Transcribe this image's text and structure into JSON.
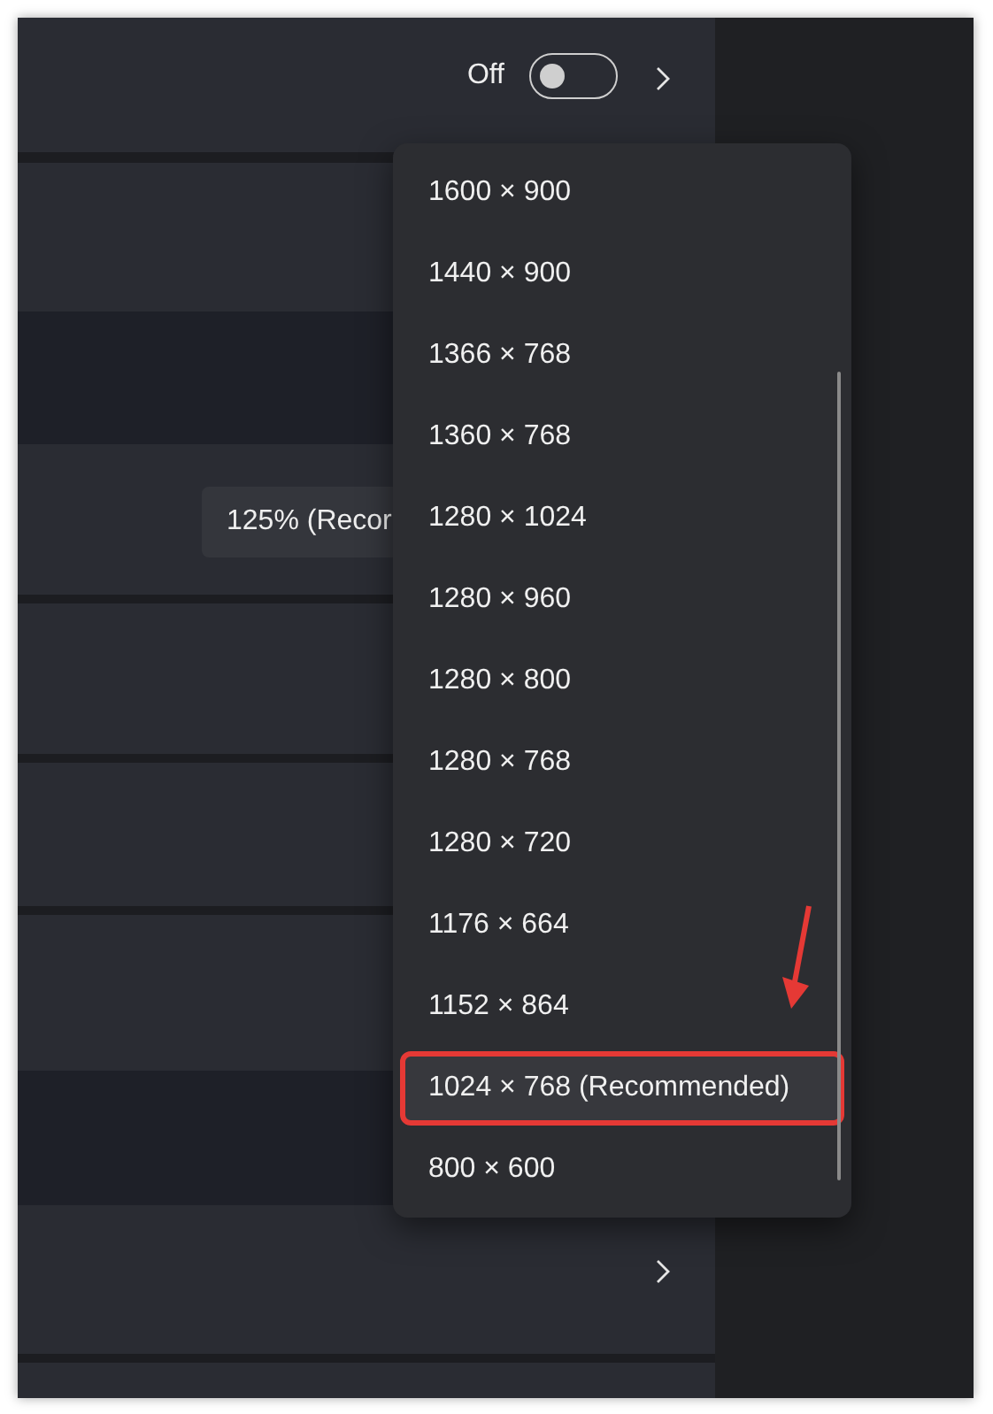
{
  "setting_rows": [
    {
      "kind": "toggle",
      "label": "Off",
      "on": false,
      "chevron": true
    },
    {
      "kind": "plain"
    },
    {
      "kind": "dark"
    },
    {
      "kind": "dropdown",
      "value": "125% (Recor"
    },
    {
      "kind": "plain"
    },
    {
      "kind": "plain"
    },
    {
      "kind": "plain"
    },
    {
      "kind": "dark"
    },
    {
      "kind": "chevron",
      "chevron": true
    },
    {
      "kind": "plain"
    }
  ],
  "resolution_menu": {
    "items": [
      {
        "label": "1600 × 900",
        "selected": false,
        "annotated": false
      },
      {
        "label": "1440 × 900",
        "selected": false,
        "annotated": false
      },
      {
        "label": "1366 × 768",
        "selected": false,
        "annotated": false
      },
      {
        "label": "1360 × 768",
        "selected": false,
        "annotated": false
      },
      {
        "label": "1280 × 1024",
        "selected": false,
        "annotated": false
      },
      {
        "label": "1280 × 960",
        "selected": false,
        "annotated": false
      },
      {
        "label": "1280 × 800",
        "selected": false,
        "annotated": false
      },
      {
        "label": "1280 × 768",
        "selected": false,
        "annotated": false
      },
      {
        "label": "1280 × 720",
        "selected": false,
        "annotated": false
      },
      {
        "label": "1176 × 664",
        "selected": false,
        "annotated": false
      },
      {
        "label": "1152 × 864",
        "selected": false,
        "annotated": false
      },
      {
        "label": "1024 × 768 (Recommended)",
        "selected": true,
        "annotated": true
      },
      {
        "label": "800 × 600",
        "selected": false,
        "annotated": false
      }
    ]
  }
}
